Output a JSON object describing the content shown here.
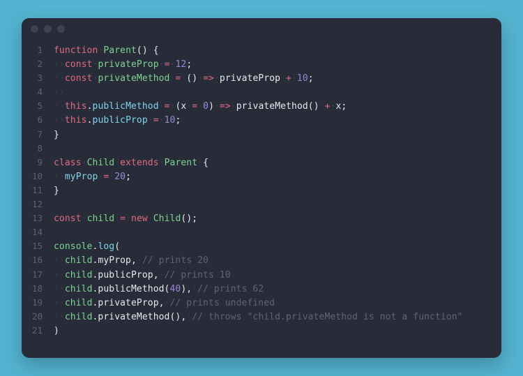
{
  "window": {
    "background_color": "#54b3d0",
    "editor_background": "#282c39",
    "titlebar_background": "#282c39",
    "traffic_lights": [
      {
        "name": "close",
        "color": "#3e4251"
      },
      {
        "name": "minimize",
        "color": "#3e4251"
      },
      {
        "name": "maximize",
        "color": "#3e4251"
      }
    ]
  },
  "theme": {
    "keyword": "#e26a84",
    "identifier": "#7ed491",
    "property": "#7fd4ec",
    "number": "#9b87d6",
    "punctuation": "#e6e9ef",
    "comment": "#5d6477",
    "line_number": "#5c6374",
    "whitespace_dot": "#3a3f4e"
  },
  "editor": {
    "language": "javascript",
    "line_numbers": [
      "1",
      "2",
      "3",
      "4",
      "5",
      "6",
      "7",
      "8",
      "9",
      "10",
      "11",
      "12",
      "13",
      "14",
      "15",
      "16",
      "17",
      "18",
      "19",
      "20",
      "21"
    ],
    "lines": [
      {
        "n": "1",
        "text": "function Parent() {"
      },
      {
        "n": "2",
        "text": "  const privateProp = 12;"
      },
      {
        "n": "3",
        "text": "  const privateMethod = () => privateProp + 10;"
      },
      {
        "n": "4",
        "text": "  "
      },
      {
        "n": "5",
        "text": "  this.publicMethod = (x = 0) => privateMethod() + x;"
      },
      {
        "n": "6",
        "text": "  this.publicProp = 10;"
      },
      {
        "n": "7",
        "text": "}"
      },
      {
        "n": "8",
        "text": ""
      },
      {
        "n": "9",
        "text": "class Child extends Parent {"
      },
      {
        "n": "10",
        "text": "  myProp = 20;"
      },
      {
        "n": "11",
        "text": "}"
      },
      {
        "n": "12",
        "text": ""
      },
      {
        "n": "13",
        "text": "const child = new Child();"
      },
      {
        "n": "14",
        "text": ""
      },
      {
        "n": "15",
        "text": "console.log("
      },
      {
        "n": "16",
        "text": "  child.myProp, // prints 20"
      },
      {
        "n": "17",
        "text": "  child.publicProp, // prints 10"
      },
      {
        "n": "18",
        "text": "  child.publicMethod(40), // prints 62"
      },
      {
        "n": "19",
        "text": "  child.privateProp, // prints undefined"
      },
      {
        "n": "20",
        "text": "  child.privateMethod(), // throws \"child.privateMethod is not a function\""
      },
      {
        "n": "21",
        "text": ")"
      }
    ],
    "tokens": {
      "l1": [
        {
          "c": "t-kw",
          "v": "function"
        },
        {
          "c": "t-dim",
          "v": "·"
        },
        {
          "c": "t-fn",
          "v": "Parent"
        },
        {
          "c": "t-punc",
          "v": "()"
        },
        {
          "c": "t-dim",
          "v": "·"
        },
        {
          "c": "t-punc",
          "v": "{"
        }
      ],
      "l2": [
        {
          "c": "t-dim",
          "v": "··"
        },
        {
          "c": "t-kw",
          "v": "const"
        },
        {
          "c": "t-dim",
          "v": "·"
        },
        {
          "c": "t-fn",
          "v": "privateProp"
        },
        {
          "c": "t-dim",
          "v": "·"
        },
        {
          "c": "t-op",
          "v": "="
        },
        {
          "c": "t-dim",
          "v": "·"
        },
        {
          "c": "t-num",
          "v": "12"
        },
        {
          "c": "t-punc",
          "v": ";"
        }
      ],
      "l3": [
        {
          "c": "t-dim",
          "v": "··"
        },
        {
          "c": "t-kw",
          "v": "const"
        },
        {
          "c": "t-dim",
          "v": "·"
        },
        {
          "c": "t-fn",
          "v": "privateMethod"
        },
        {
          "c": "t-dim",
          "v": "·"
        },
        {
          "c": "t-op",
          "v": "="
        },
        {
          "c": "t-dim",
          "v": "·"
        },
        {
          "c": "t-punc",
          "v": "()"
        },
        {
          "c": "t-dim",
          "v": "·"
        },
        {
          "c": "t-op",
          "v": "=>"
        },
        {
          "c": "t-dim",
          "v": "·"
        },
        {
          "c": "t-punc",
          "v": "privateProp"
        },
        {
          "c": "t-dim",
          "v": "·"
        },
        {
          "c": "t-op",
          "v": "+"
        },
        {
          "c": "t-dim",
          "v": "·"
        },
        {
          "c": "t-num",
          "v": "10"
        },
        {
          "c": "t-punc",
          "v": ";"
        }
      ],
      "l4": [
        {
          "c": "t-dim",
          "v": "··"
        }
      ],
      "l5": [
        {
          "c": "t-dim",
          "v": "··"
        },
        {
          "c": "t-kw",
          "v": "this"
        },
        {
          "c": "t-punc",
          "v": "."
        },
        {
          "c": "t-prop",
          "v": "publicMethod"
        },
        {
          "c": "t-dim",
          "v": "·"
        },
        {
          "c": "t-op",
          "v": "="
        },
        {
          "c": "t-dim",
          "v": "·"
        },
        {
          "c": "t-punc",
          "v": "("
        },
        {
          "c": "t-punc",
          "v": "x"
        },
        {
          "c": "t-dim",
          "v": "·"
        },
        {
          "c": "t-op",
          "v": "="
        },
        {
          "c": "t-dim",
          "v": "·"
        },
        {
          "c": "t-num",
          "v": "0"
        },
        {
          "c": "t-punc",
          "v": ")"
        },
        {
          "c": "t-dim",
          "v": "·"
        },
        {
          "c": "t-op",
          "v": "=>"
        },
        {
          "c": "t-dim",
          "v": "·"
        },
        {
          "c": "t-punc",
          "v": "privateMethod()"
        },
        {
          "c": "t-dim",
          "v": "·"
        },
        {
          "c": "t-op",
          "v": "+"
        },
        {
          "c": "t-dim",
          "v": "·"
        },
        {
          "c": "t-punc",
          "v": "x;"
        }
      ],
      "l6": [
        {
          "c": "t-dim",
          "v": "··"
        },
        {
          "c": "t-kw",
          "v": "this"
        },
        {
          "c": "t-punc",
          "v": "."
        },
        {
          "c": "t-prop",
          "v": "publicProp"
        },
        {
          "c": "t-dim",
          "v": "·"
        },
        {
          "c": "t-op",
          "v": "="
        },
        {
          "c": "t-dim",
          "v": "·"
        },
        {
          "c": "t-num",
          "v": "10"
        },
        {
          "c": "t-punc",
          "v": ";"
        }
      ],
      "l7": [
        {
          "c": "t-punc",
          "v": "}"
        }
      ],
      "l8": [],
      "l9": [
        {
          "c": "t-kw",
          "v": "class"
        },
        {
          "c": "t-dim",
          "v": "·"
        },
        {
          "c": "t-fn",
          "v": "Child"
        },
        {
          "c": "t-dim",
          "v": "·"
        },
        {
          "c": "t-kw",
          "v": "extends"
        },
        {
          "c": "t-dim",
          "v": "·"
        },
        {
          "c": "t-fn",
          "v": "Parent"
        },
        {
          "c": "t-dim",
          "v": "·"
        },
        {
          "c": "t-punc",
          "v": "{"
        }
      ],
      "l10": [
        {
          "c": "t-dim",
          "v": "··"
        },
        {
          "c": "t-prop",
          "v": "myProp"
        },
        {
          "c": "t-dim",
          "v": "·"
        },
        {
          "c": "t-op",
          "v": "="
        },
        {
          "c": "t-dim",
          "v": "·"
        },
        {
          "c": "t-num",
          "v": "20"
        },
        {
          "c": "t-punc",
          "v": ";"
        }
      ],
      "l11": [
        {
          "c": "t-punc",
          "v": "}"
        }
      ],
      "l12": [],
      "l13": [
        {
          "c": "t-kw",
          "v": "const"
        },
        {
          "c": "t-dim",
          "v": "·"
        },
        {
          "c": "t-fn",
          "v": "child"
        },
        {
          "c": "t-dim",
          "v": "·"
        },
        {
          "c": "t-op",
          "v": "="
        },
        {
          "c": "t-dim",
          "v": "·"
        },
        {
          "c": "t-kw",
          "v": "new"
        },
        {
          "c": "t-dim",
          "v": "·"
        },
        {
          "c": "t-fn",
          "v": "Child"
        },
        {
          "c": "t-punc",
          "v": "();"
        }
      ],
      "l14": [],
      "l15": [
        {
          "c": "t-fn",
          "v": "console"
        },
        {
          "c": "t-punc",
          "v": "."
        },
        {
          "c": "t-prop",
          "v": "log"
        },
        {
          "c": "t-punc",
          "v": "("
        }
      ],
      "l16": [
        {
          "c": "t-dim",
          "v": "··"
        },
        {
          "c": "t-fn",
          "v": "child"
        },
        {
          "c": "t-punc",
          "v": ".myProp,"
        },
        {
          "c": "t-dim",
          "v": "·"
        },
        {
          "c": "t-com",
          "v": "// prints 20"
        }
      ],
      "l17": [
        {
          "c": "t-dim",
          "v": "··"
        },
        {
          "c": "t-fn",
          "v": "child"
        },
        {
          "c": "t-punc",
          "v": ".publicProp,"
        },
        {
          "c": "t-dim",
          "v": "·"
        },
        {
          "c": "t-com",
          "v": "// prints 10"
        }
      ],
      "l18": [
        {
          "c": "t-dim",
          "v": "··"
        },
        {
          "c": "t-fn",
          "v": "child"
        },
        {
          "c": "t-punc",
          "v": ".publicMethod("
        },
        {
          "c": "t-num",
          "v": "40"
        },
        {
          "c": "t-punc",
          "v": "),"
        },
        {
          "c": "t-dim",
          "v": "·"
        },
        {
          "c": "t-com",
          "v": "// prints 62"
        }
      ],
      "l19": [
        {
          "c": "t-dim",
          "v": "··"
        },
        {
          "c": "t-fn",
          "v": "child"
        },
        {
          "c": "t-punc",
          "v": ".privateProp,"
        },
        {
          "c": "t-dim",
          "v": "·"
        },
        {
          "c": "t-com",
          "v": "// prints undefined"
        }
      ],
      "l20": [
        {
          "c": "t-dim",
          "v": "··"
        },
        {
          "c": "t-fn",
          "v": "child"
        },
        {
          "c": "t-punc",
          "v": ".privateMethod(),"
        },
        {
          "c": "t-dim",
          "v": "·"
        },
        {
          "c": "t-com",
          "v": "// throws \"child.privateMethod is not a function\""
        }
      ],
      "l21": [
        {
          "c": "t-punc",
          "v": ")"
        }
      ]
    }
  }
}
